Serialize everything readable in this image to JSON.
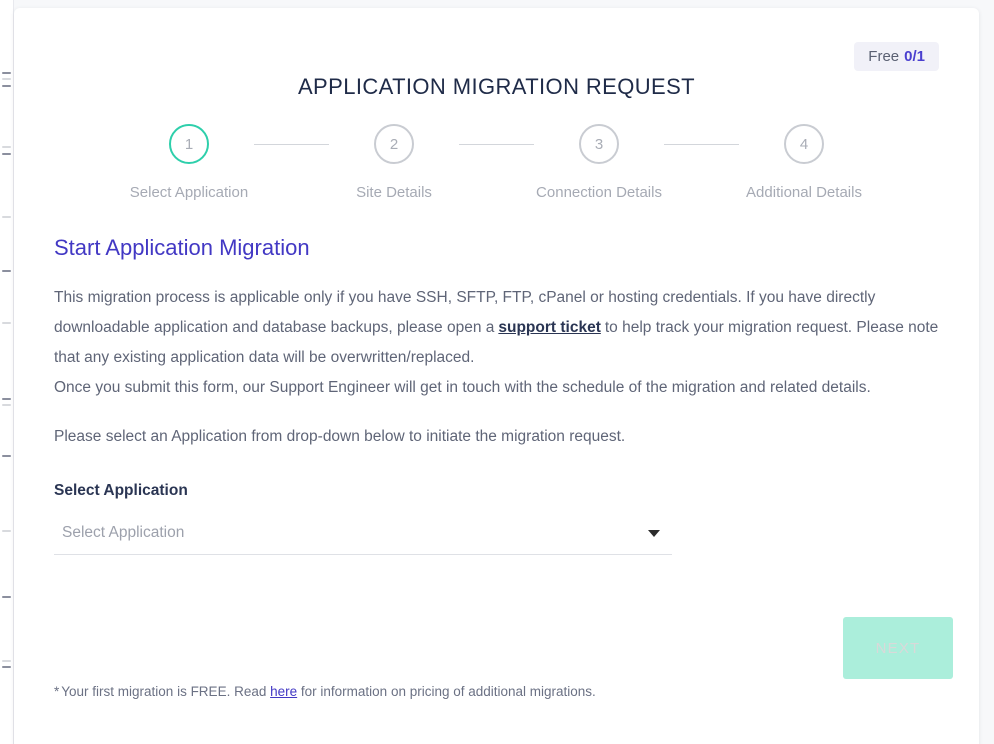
{
  "badge": {
    "label": "Free",
    "count": "0/1"
  },
  "modal": {
    "title": "APPLICATION MIGRATION REQUEST"
  },
  "stepper": {
    "steps": [
      {
        "number": "1",
        "label": "Select Application",
        "active": true
      },
      {
        "number": "2",
        "label": "Site Details",
        "active": false
      },
      {
        "number": "3",
        "label": "Connection Details",
        "active": false
      },
      {
        "number": "4",
        "label": "Additional Details",
        "active": false
      }
    ]
  },
  "content": {
    "heading": "Start Application Migration",
    "paragraph_1_part_1": "This migration process is applicable only if you have SSH, SFTP, FTP, cPanel or hosting credentials. If you have directly downloadable application and database backups, please open a",
    "support_link": "support ticket",
    "paragraph_1_part_2": "to help track your migration request. Please note that any existing application data will be overwritten/replaced.",
    "paragraph_2": "Once you submit this form, our Support Engineer will get in touch with the schedule of the migration and related details.",
    "paragraph_3": "Please select an Application from drop-down below to initiate the migration request."
  },
  "field": {
    "label": "Select Application",
    "placeholder": "Select Application",
    "value": "Select Application",
    "caret_icon": "chevron-down-icon"
  },
  "actions": {
    "next_label": "NEXT"
  },
  "footnote": {
    "star": "*",
    "text_before": "Your first migration is FREE. Read",
    "link": "here",
    "text_after": "for information on pricing of additional migrations."
  },
  "colors": {
    "accent_teal": "#2ecfab",
    "heading_purple": "#4238c4",
    "badge_count": "#4a3fcf",
    "next_button_bg": "#abeedb",
    "title_navy": "#1f2b48"
  }
}
